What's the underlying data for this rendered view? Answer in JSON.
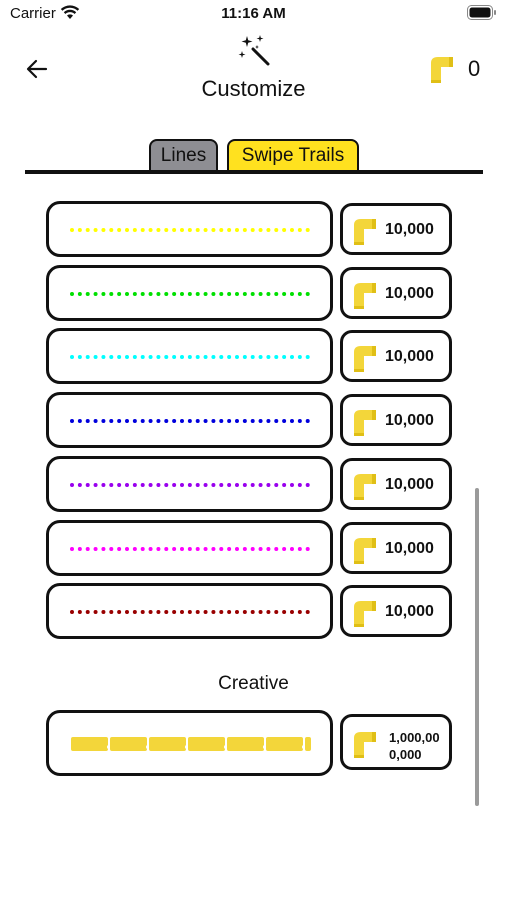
{
  "status_bar": {
    "carrier": "Carrier",
    "time": "11:16 AM"
  },
  "header": {
    "title": "Customize",
    "coin_count": "0",
    "back_icon": "back-arrow-icon",
    "magic_icon": "magic-wand-icon",
    "coin_icon": "gold-pipe-icon"
  },
  "tabs": [
    {
      "label": "Lines",
      "selected": false,
      "color": "#8e8e93"
    },
    {
      "label": "Swipe Trails",
      "selected": true,
      "color": "#ffe11f"
    }
  ],
  "trails": [
    {
      "color": "#ffff00",
      "price": "10,000"
    },
    {
      "color": "#00e000",
      "price": "10,000"
    },
    {
      "color": "#00ffff",
      "price": "10,000"
    },
    {
      "color": "#0000dd",
      "price": "10,000"
    },
    {
      "color": "#9900ee",
      "price": "10,000"
    },
    {
      "color": "#ff00ff",
      "price": "10,000"
    },
    {
      "color": "#990000",
      "price": "10,000"
    }
  ],
  "creative": {
    "section_title": "Creative",
    "price": "1,000,000,000",
    "plank_color": "#f3d63a"
  }
}
